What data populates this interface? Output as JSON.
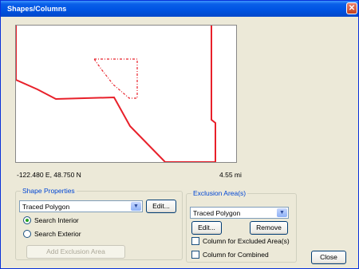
{
  "window": {
    "title": "Shapes/Columns",
    "close_glyph": "✕"
  },
  "map": {
    "coordinates": "-122.480 E,   48.750 N",
    "scale": "4.55 mi",
    "colors": {
      "outline": "#e8202a",
      "exclusion": "#e8202a"
    }
  },
  "shape_properties": {
    "title": "Shape Properties",
    "selected_shape": "Traced Polygon",
    "edit_label": "Edit...",
    "search_interior": "Search Interior",
    "search_exterior": "Search Exterior",
    "search_interior_checked": true,
    "add_exclusion_label": "Add Exclusion Area"
  },
  "exclusion_areas": {
    "title": "Exclusion Area(s)",
    "selected_shape": "Traced Polygon",
    "edit_label": "Edit...",
    "remove_label": "Remove",
    "column_excluded": "Column for Excluded Area(s)",
    "column_combined": "Column for Combined"
  },
  "close_label": "Close"
}
